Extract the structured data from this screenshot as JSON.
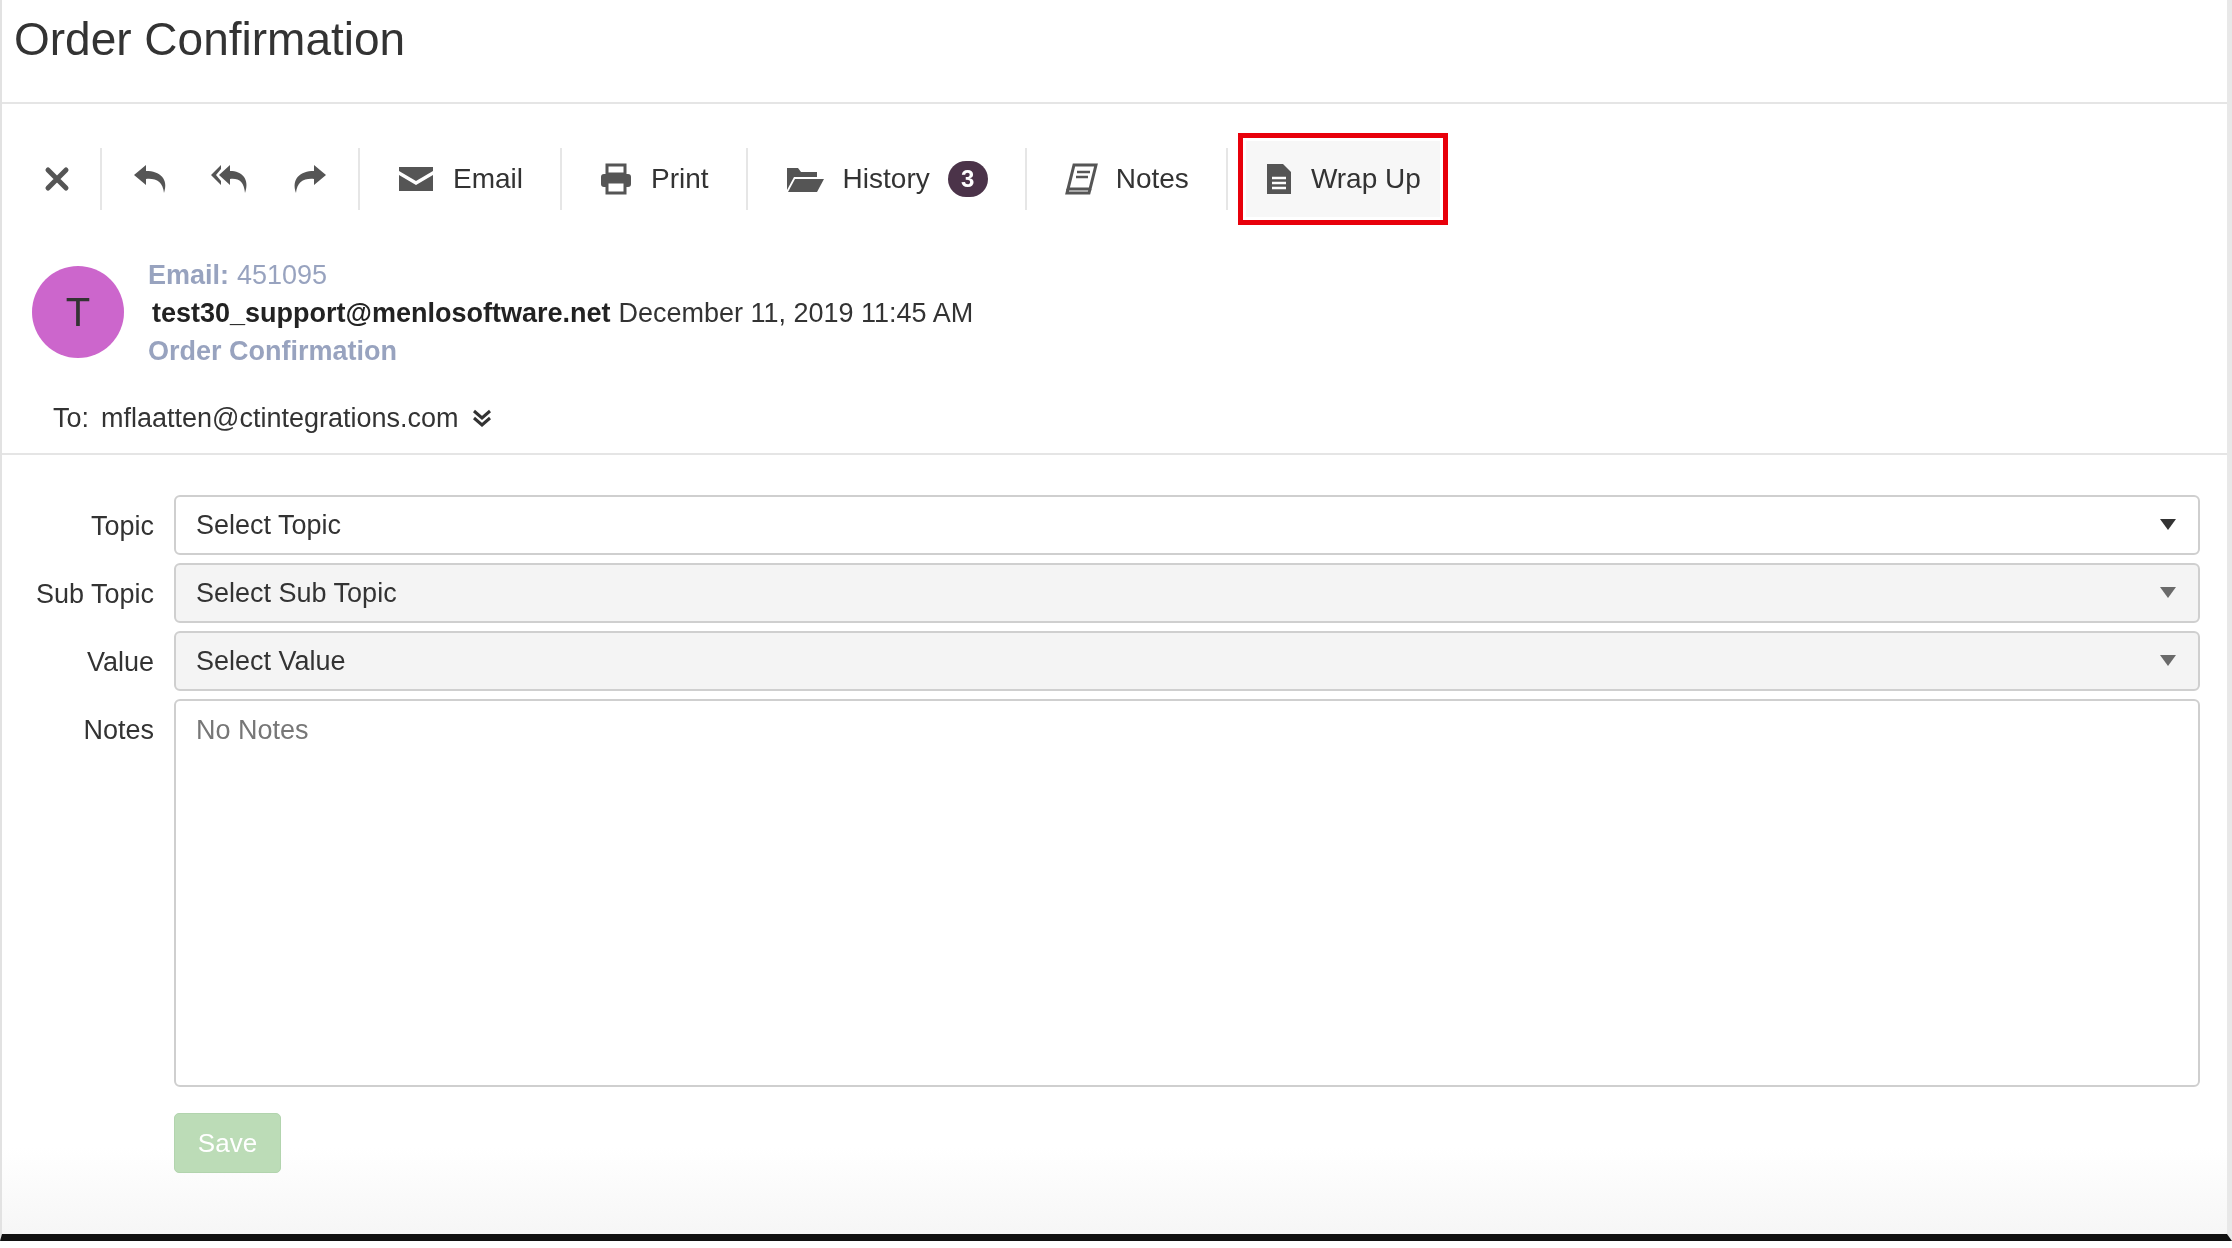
{
  "title": "Order Confirmation",
  "toolbar": {
    "actions": [
      {
        "kind": "close"
      },
      {
        "kind": "reply"
      },
      {
        "kind": "reply-all"
      },
      {
        "kind": "forward"
      }
    ],
    "tabs": [
      {
        "kind": "email",
        "label": "Email",
        "selected": false
      },
      {
        "kind": "print",
        "label": "Print",
        "selected": false
      },
      {
        "kind": "history",
        "label": "History",
        "badge": "3",
        "selected": false
      },
      {
        "kind": "notes",
        "label": "Notes",
        "selected": false
      },
      {
        "kind": "wrapup",
        "label": "Wrap Up",
        "selected": true
      }
    ]
  },
  "message": {
    "avatar": {
      "initial": "T",
      "color": "#cc66cc"
    },
    "id_label": "Email:",
    "id": "451095",
    "sender": "test30_support@menlosoftware.net",
    "date": "December 11, 2019 11:45 AM",
    "subject": "Order Confirmation",
    "to_label": "To:",
    "to": "mflaatten@ctintegrations.com"
  },
  "form": {
    "fields": [
      {
        "kind": "select",
        "label": "Topic",
        "placeholder": "Select Topic",
        "disabled": false
      },
      {
        "kind": "select",
        "label": "Sub Topic",
        "placeholder": "Select Sub Topic",
        "disabled": true
      },
      {
        "kind": "select",
        "label": "Value",
        "placeholder": "Select Value",
        "disabled": true
      },
      {
        "kind": "textarea",
        "label": "Notes",
        "placeholder": "No Notes"
      }
    ],
    "save": {
      "label": "Save",
      "disabled": true
    }
  }
}
